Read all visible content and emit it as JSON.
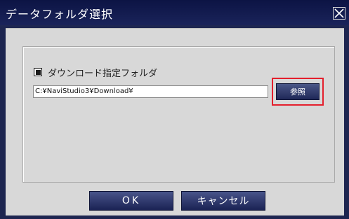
{
  "window": {
    "title": "データフォルダ選択",
    "close_icon": "close-icon"
  },
  "folder_option": {
    "checkbox_checked": true,
    "label": "ダウンロード指定フォルダ",
    "path_value": "C:¥NaviStudio3¥Download¥",
    "browse_label": "参照",
    "highlight_color": "#e41f2c"
  },
  "footer": {
    "ok_label": "OK",
    "cancel_label": "キャンセル"
  }
}
